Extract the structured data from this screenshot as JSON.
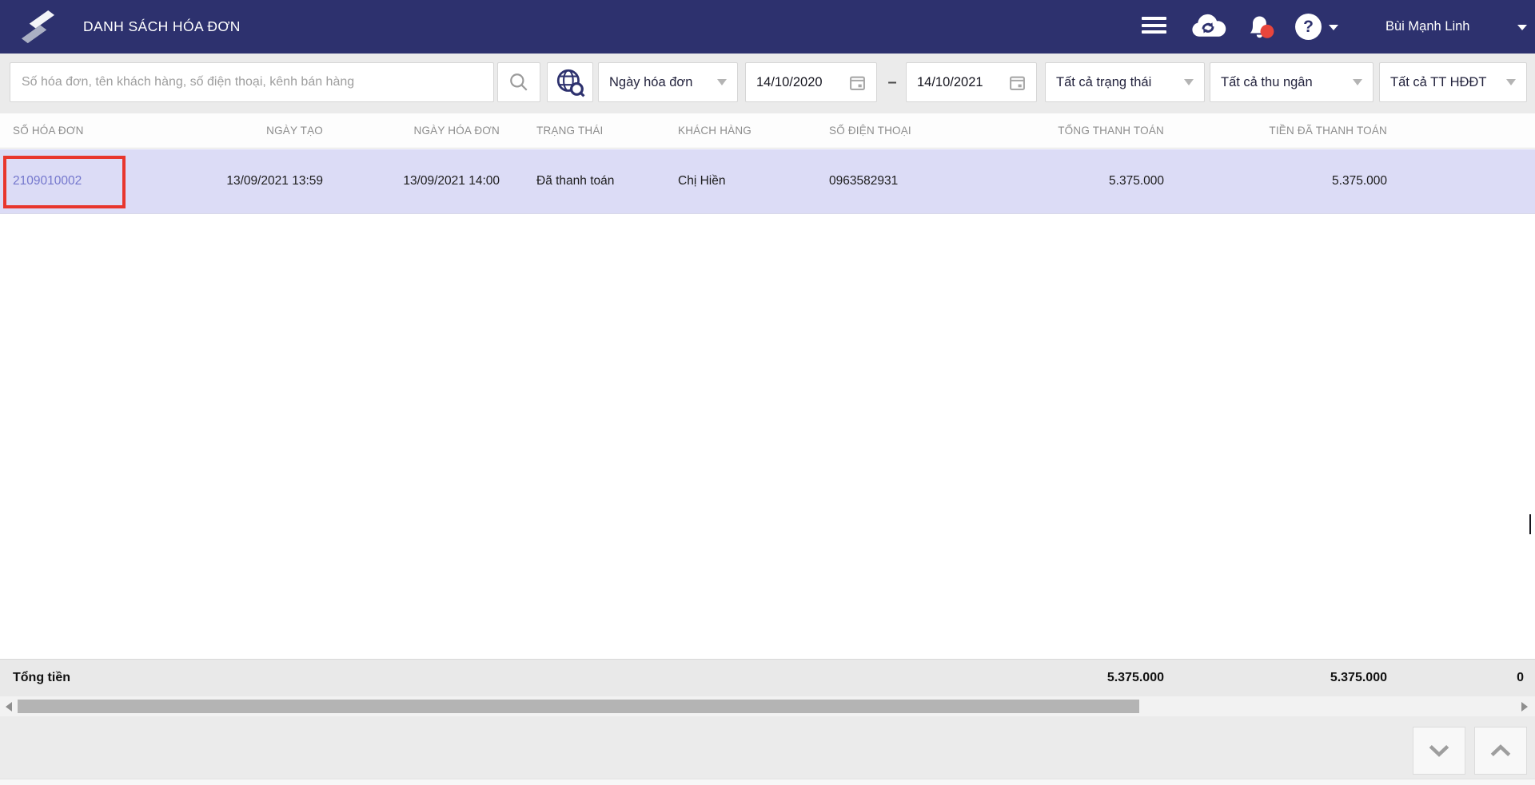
{
  "navbar": {
    "title": "DANH SÁCH HÓA ĐƠN",
    "user_name": "Bùi Mạnh Linh"
  },
  "filters": {
    "search_placeholder": "Số hóa đơn, tên khách hàng, số điện thoại, kênh bán hàng",
    "search_value": "",
    "date_type": "Ngày hóa đơn",
    "date_from": "14/10/2020",
    "range_separator": "–",
    "date_to": "14/10/2021",
    "status": "Tất cả trạng thái",
    "cashier": "Tất cả thu ngân",
    "einvoice": "Tất cả TT HĐĐT"
  },
  "table": {
    "columns": [
      "SỐ HÓA ĐƠN",
      "NGÀY TẠO",
      "NGÀY HÓA ĐƠN",
      "TRẠNG THÁI",
      "KHÁCH HÀNG",
      "SỐ ĐIỆN THOẠI",
      "TỔNG THANH TOÁN",
      "TIỀN ĐÃ THANH TOÁN"
    ],
    "rows": [
      {
        "invoice_no": "2109010002",
        "created_at": "13/09/2021 13:59",
        "invoice_date": "13/09/2021 14:00",
        "status": "Đã thanh toán",
        "customer": "Chị Hiền",
        "phone": "0963582931",
        "total_payment": "5.375.000",
        "paid_amount": "5.375.000"
      }
    ],
    "footer": {
      "label": "Tổng tiền",
      "total_payment": "5.375.000",
      "paid_amount": "5.375.000",
      "remaining": "0"
    }
  },
  "icons": {
    "help_glyph": "?",
    "logo": "sapo-s-logo",
    "menu": "hamburger",
    "sync": "cloud-sync",
    "notifications": "bell-with-red-badge",
    "help": "question-circle",
    "search": "magnifier",
    "channel": "globe-search",
    "calendar": "calendar",
    "dropdown": "caret-down",
    "pager": "chevron-down / chevron-up"
  },
  "colors": {
    "navbar_bg": "#2d316e",
    "filter_bar_bg": "#ebebeb",
    "row_highlight": "#dcdcf6",
    "link": "#7477cd",
    "annotation_red": "#e8362d",
    "notification_badge": "#e8453c",
    "footer_bg": "#e9e9e9"
  }
}
